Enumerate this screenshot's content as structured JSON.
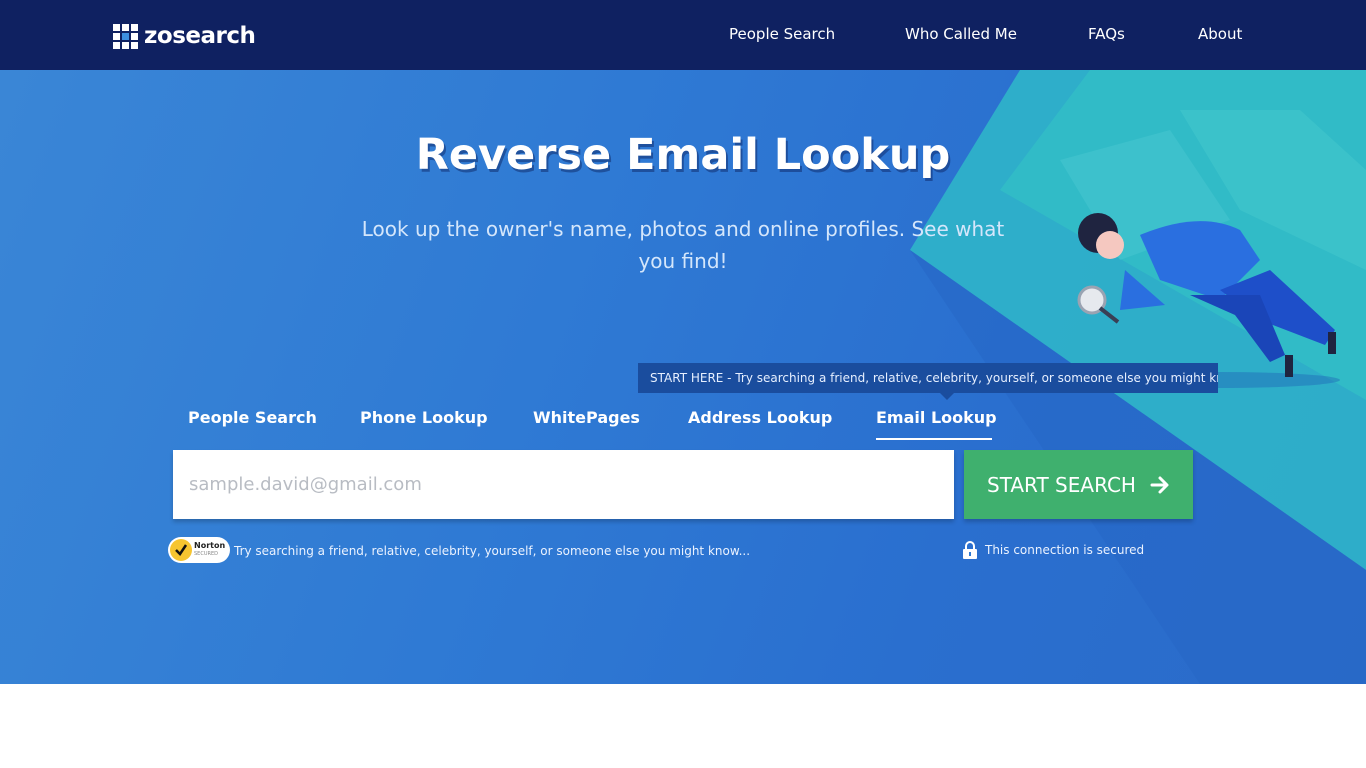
{
  "brand": {
    "logo_text": "zosearch"
  },
  "nav": {
    "items": [
      {
        "label": "People Search"
      },
      {
        "label": "Who Called Me"
      },
      {
        "label": "FAQs"
      },
      {
        "label": "About"
      }
    ]
  },
  "hero": {
    "title": "Reverse Email Lookup",
    "subtitle": "Look up the owner's name, photos and online profiles. See what you find!",
    "tooltip": "START HERE - Try searching a friend, relative, celebrity, yourself, or someone else you might know..."
  },
  "tabs": {
    "items": [
      {
        "label": "People Search"
      },
      {
        "label": "Phone Lookup"
      },
      {
        "label": "WhitePages"
      },
      {
        "label": "Address Lookup"
      },
      {
        "label": "Email Lookup"
      }
    ],
    "active": "Email Lookup"
  },
  "search": {
    "placeholder": "sample.david@gmail.com",
    "value": "",
    "button_label": "START SEARCH"
  },
  "footer_hints": {
    "norton_label": "Norton",
    "norton_sub": "SECURED",
    "hint": "Try searching a friend, relative, celebrity, yourself, or someone else you might know...",
    "secure": "This connection is secured"
  },
  "colors": {
    "navbar": "#0f2161",
    "hero": "#2f7ad4",
    "button": "#3fb06e",
    "tooltip": "#1a4d9e"
  },
  "icons": [
    "zosearch-logo-icon",
    "arrow-right-icon",
    "norton-check-icon",
    "lock-icon",
    "magnifier-icon"
  ]
}
